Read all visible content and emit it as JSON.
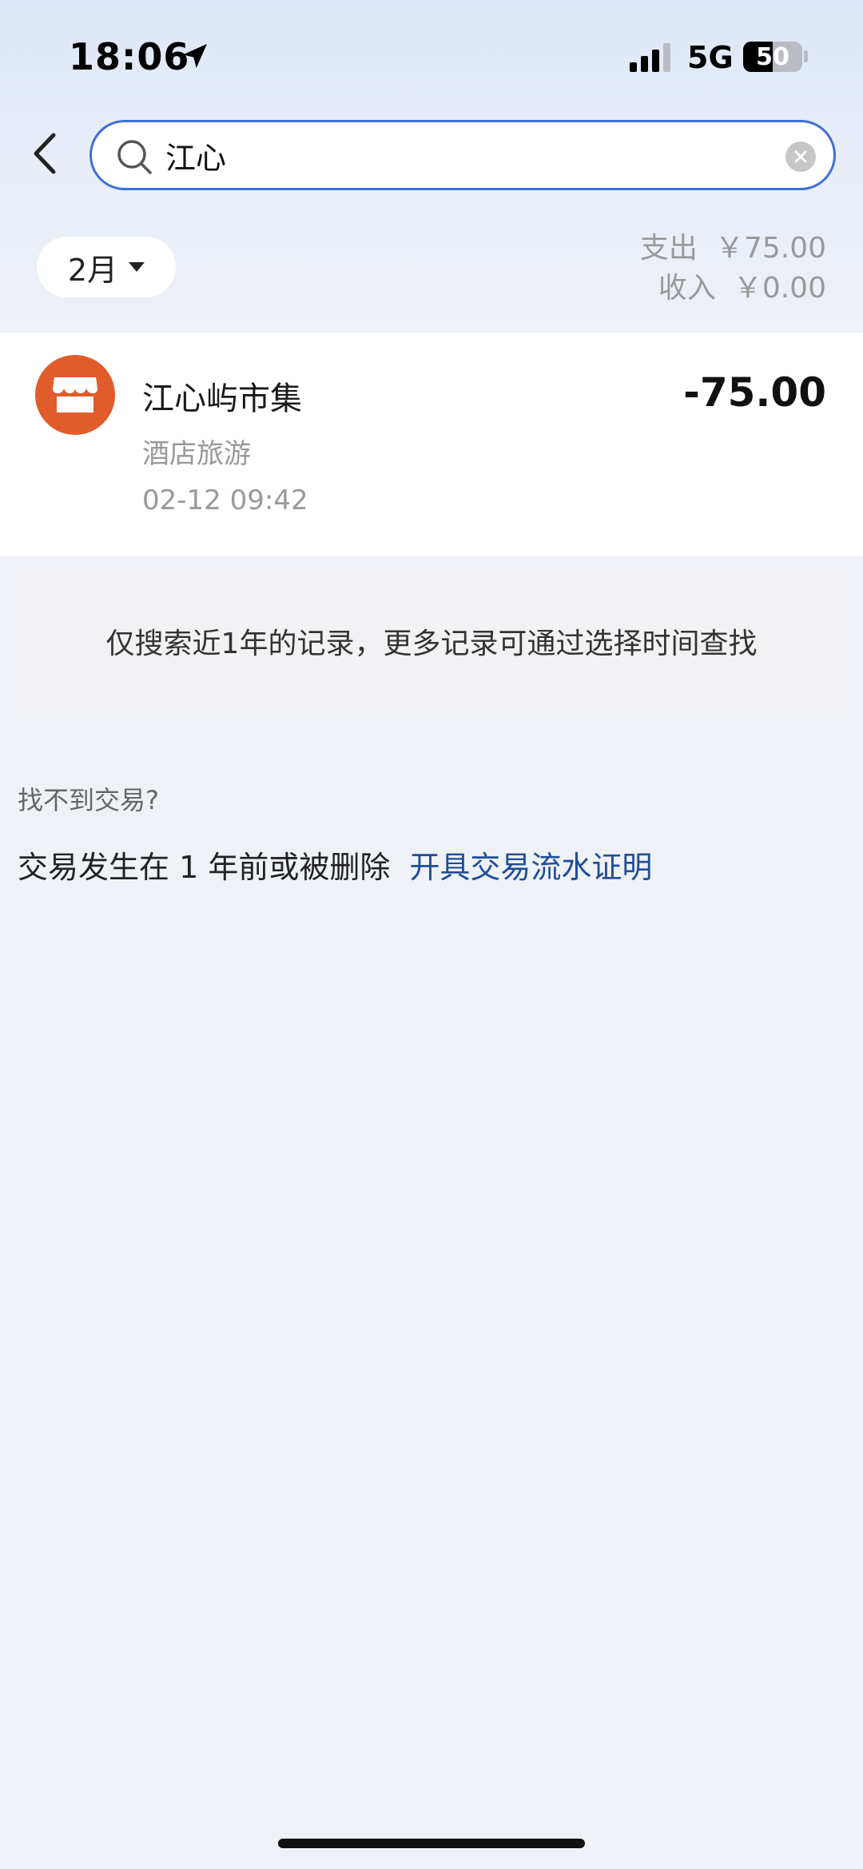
{
  "status_bar": {
    "time": "18:06",
    "network": "5G",
    "battery": "50",
    "battery_level": 0.5
  },
  "search": {
    "value": "江心",
    "placeholder": ""
  },
  "filter": {
    "month": "2月",
    "summary": {
      "expense_label": "支出",
      "expense_value": "￥75.00",
      "income_label": "收入",
      "income_value": "￥0.00"
    }
  },
  "transactions": [
    {
      "merchant": "江心屿市集",
      "category": "酒店旅游",
      "datetime": "02-12 09:42",
      "amount": "-75.00",
      "icon": "store-icon",
      "icon_color": "#e15c2b"
    }
  ],
  "notice": "仅搜索近1年的记录，更多记录可通过选择时间查找",
  "help": {
    "title": "找不到交易?",
    "reason": "交易发生在 1 年前或被删除",
    "link": "开具交易流水证明"
  },
  "colors": {
    "accent": "#3f6fd6",
    "link": "#1f4e96",
    "merchant_icon": "#e15c2b"
  }
}
